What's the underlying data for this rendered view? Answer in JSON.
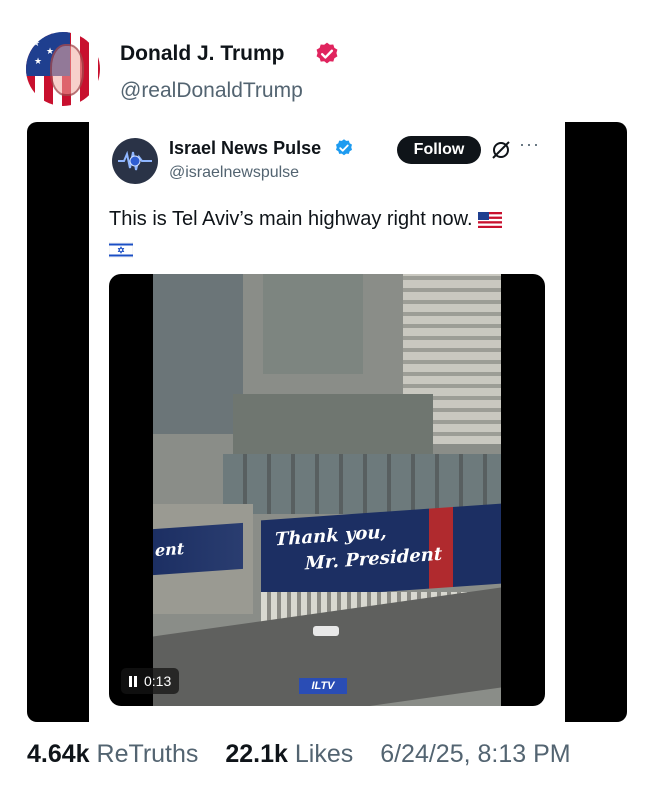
{
  "post": {
    "author_name": "Donald J. Trump",
    "author_handle": "@realDonaldTrump",
    "verified_icon": "verified-badge-icon",
    "avatar_icon": "flag-portrait-avatar"
  },
  "embedded_post": {
    "author_name": "Israel News Pulse",
    "author_handle": "@israelnewspulse",
    "follow_label": "Follow",
    "more_label": "···",
    "text": "This is Tel Aviv’s main highway right now.",
    "flags": [
      "us-flag-icon",
      "israel-flag-icon"
    ],
    "video": {
      "time": "0:13",
      "banner_line1": "Thank you,",
      "banner_line2": "Mr. President",
      "banner_left_text": "ent",
      "watermark": "ILTV"
    }
  },
  "footer": {
    "retruths_count": "4.64k",
    "retruths_label": "ReTruths",
    "likes_count": "22.1k",
    "likes_label": "Likes",
    "timestamp": "6/24/25, 8:13 PM"
  },
  "colors": {
    "verified": "#e0245e",
    "embedded_verified": "#1d9bf0",
    "text_muted": "#536471",
    "text_main": "#0f1419"
  }
}
